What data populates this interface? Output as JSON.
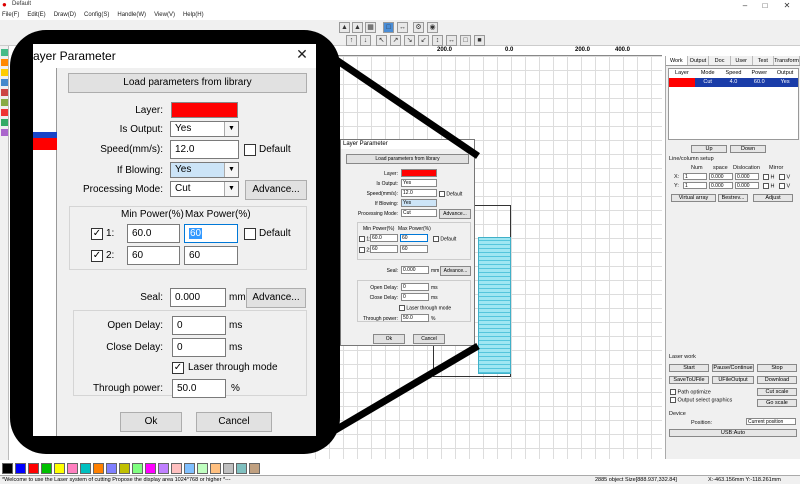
{
  "app": {
    "title": "Default",
    "menu": [
      "File(F)",
      "Edit(E)",
      "Draw(D)",
      "Config(S)",
      "Handle(W)",
      "View(V)",
      "Help(H)"
    ],
    "ruler_marks": [
      "200.0",
      "0.0",
      "200.0",
      "400.0"
    ],
    "status_left": "*Welcome to use the Laser system of cutting Propose the display area 1024*768 or higher *---",
    "status_mid": "2885 object Size[888.937,332.84]",
    "status_right": "X:-463.156mm Y:-118.261mm"
  },
  "right_panel": {
    "tabs": [
      "Work",
      "Output",
      "Doc",
      "User",
      "Test",
      "Transform"
    ],
    "layer_headers": [
      "Layer",
      "Mode",
      "Speed",
      "Power",
      "Output"
    ],
    "layer_row": {
      "mode": "Cut",
      "speed": "4.0",
      "power": "60.0",
      "output": "Yes"
    },
    "up": "Up",
    "down": "Down",
    "line_column_setup": "Line/column setup",
    "lc_headers": [
      "Num",
      "space",
      "Dislocation",
      "Mirror"
    ],
    "x_label": "X:",
    "y_label": "Y:",
    "x_num": "1",
    "x_space": "0.000",
    "x_disloc": "0.000",
    "y_num": "1",
    "y_space": "0.000",
    "y_disloc": "0.000",
    "mirror_h": "H",
    "mirror_v": "V",
    "virtual_array": "Virtual array",
    "bestrev": "Bestrev...",
    "adjust": "Adjust",
    "laser_work": "Laser work",
    "start": "Start",
    "pause": "Pause/Continue",
    "stop": "Stop",
    "save_to_ufile": "SaveToUFile",
    "ufile_output": "UFileOutput",
    "download": "Download",
    "path_optimize": "Path optimize",
    "output_select": "Output select graphics",
    "cut_scale": "Cut scale",
    "go_scale": "Go scale",
    "device": "Device",
    "position_label": "Position:",
    "position_value": "Current position",
    "usb": "USB:Auto"
  },
  "dialog": {
    "title": "Layer Parameter",
    "title_clipped": "ayer Parameter",
    "load_params": "Load parameters from library",
    "layer_label": "Layer:",
    "layer_color": "#ff0000",
    "is_output_label": "Is Output:",
    "is_output_value": "Yes",
    "speed_label": "Speed(mm/s):",
    "speed_value": "12.0",
    "default_label": "Default",
    "if_blowing_label": "If Blowing:",
    "if_blowing_value": "Yes",
    "processing_mode_label": "Processing Mode:",
    "processing_mode_value": "Cut",
    "advance": "Advance...",
    "min_power_label": "Min Power(%)",
    "max_power_label": "Max Power(%)",
    "row1_label": "1:",
    "row1_min": "60.0",
    "row1_max": "60",
    "row2_label": "2:",
    "row2_min": "60",
    "row2_max": "60",
    "seal_label": "Seal:",
    "seal_value": "0.000",
    "seal_unit": "mm",
    "open_delay_label": "Open Delay:",
    "open_delay_value": "0",
    "close_delay_label": "Close Delay:",
    "close_delay_value": "0",
    "delay_unit": "ms",
    "laser_through_label": "Laser through mode",
    "through_power_label": "Through power:",
    "through_power_value": "50.0",
    "percent": "%",
    "ok": "Ok",
    "cancel": "Cancel"
  },
  "palette_colors": [
    "#000000",
    "#0000ff",
    "#ff0000",
    "#00c000",
    "#ffff00",
    "#ff80c0",
    "#00c0c0",
    "#ff8000",
    "#8080ff",
    "#c0c000",
    "#80ff80",
    "#ff00ff",
    "#c080ff",
    "#ffc0c0",
    "#80c0ff",
    "#c0ffc0",
    "#ffc080",
    "#c0c0c0",
    "#80c0c0",
    "#c0a080"
  ]
}
